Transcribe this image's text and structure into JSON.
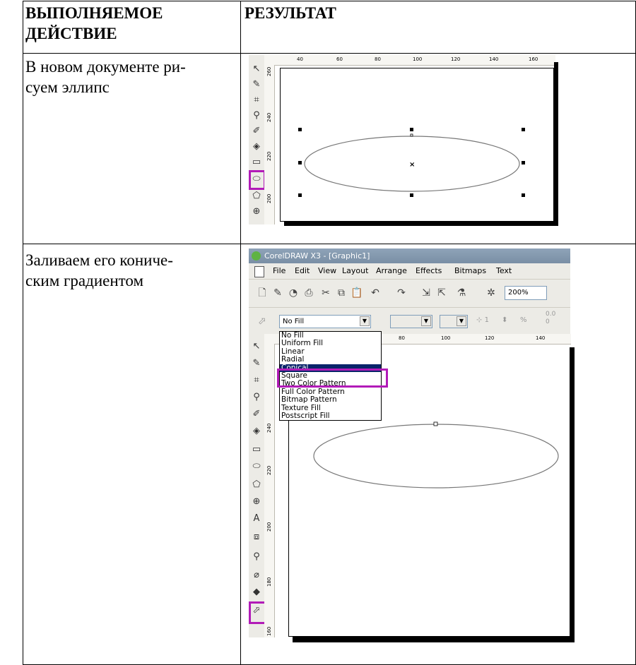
{
  "table": {
    "header_action": [
      "ВЫПОЛНЯЕМОЕ",
      "ДЕЙСТВИЕ"
    ],
    "header_result": "РЕЗУЛЬТАТ",
    "row1_text": [
      "В новом документе ри-",
      "суем эллипс"
    ],
    "row2_text": [
      "Заливаем его кониче-",
      "ским градиентом"
    ]
  },
  "shot1": {
    "ruler_h": [
      "40",
      "60",
      "80",
      "100",
      "120",
      "140",
      "160"
    ],
    "ruler_v": [
      "260",
      "240",
      "220",
      "200"
    ]
  },
  "shot2": {
    "title": "CorelDRAW X3 - [Graphic1]",
    "menu": [
      "File",
      "Edit",
      "View",
      "Layout",
      "Arrange",
      "Effects",
      "Bitmaps",
      "Text"
    ],
    "zoom": "200%",
    "fill_select": "No Fill",
    "fill_options": [
      "No Fill",
      "Uniform Fill",
      "Linear",
      "Radial",
      "Conical",
      "Square",
      "Two Color Pattern",
      "Full Color Pattern",
      "Bitmap Pattern",
      "Texture Fill",
      "Postscript Fill"
    ],
    "selected_option": "Conical",
    "angle": "1",
    "percent_sign": "%",
    "ruler_h": [
      "80",
      "100",
      "120",
      "140"
    ],
    "ruler_v": [
      "240",
      "220",
      "200",
      "180",
      "160"
    ],
    "offset_a": "0.0",
    "offset_b": "0"
  },
  "colors": {
    "highlight": "#b21bb8",
    "selection": "#0a246a"
  }
}
